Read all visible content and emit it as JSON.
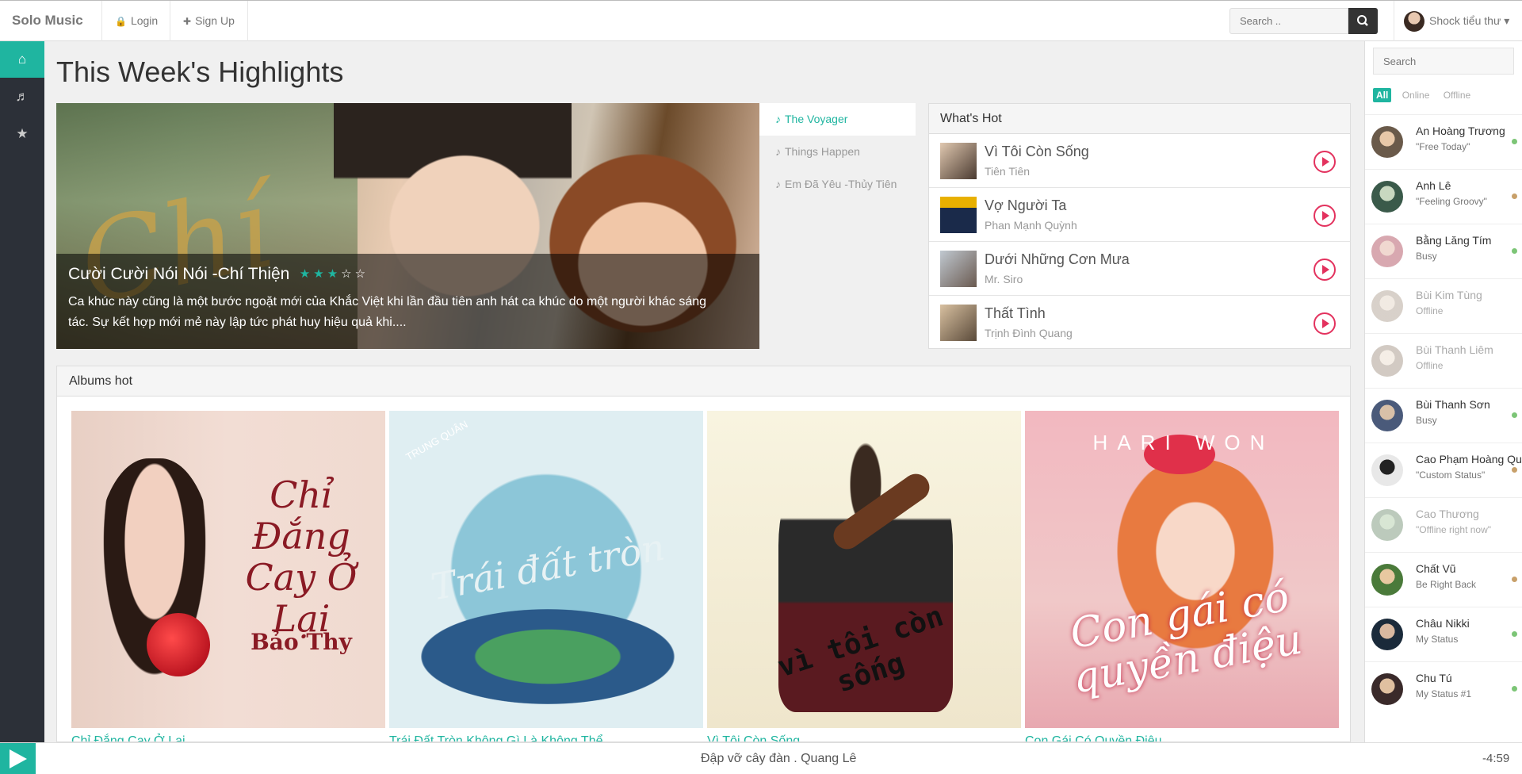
{
  "app": {
    "brand": "Solo Music"
  },
  "nav": {
    "login": "Login",
    "signup": "Sign Up",
    "search_placeholder": "Search ..",
    "user_name": "Shock tiểu thư"
  },
  "main": {
    "page_title": "This Week's Highlights",
    "slider": {
      "title": "Cười Cười Nói Nói -Chí Thiện",
      "rating": 3,
      "rating_max": 5,
      "description": "Ca khúc này cũng là một bước ngoặt mới của Khắc Việt khi lần đầu tiên anh hát ca khúc do một người khác sáng tác. Sự kết hợp mới mẻ này lập tức phát huy hiệu quả khi....",
      "tabs": [
        "The Voyager",
        "Things Happen",
        "Em Đã Yêu -Thủy Tiên"
      ]
    },
    "hot": {
      "heading": "What's Hot",
      "items": [
        {
          "title": "Vì Tôi Còn Sống",
          "artist": "Tiên Tiên"
        },
        {
          "title": "Vợ Người Ta",
          "artist": "Phan Mạnh Quỳnh"
        },
        {
          "title": "Dưới Những Cơn Mưa",
          "artist": "Mr. Siro"
        },
        {
          "title": "Thất Tình",
          "artist": "Trịnh Đình Quang"
        }
      ]
    },
    "albums": {
      "heading": "Albums hot",
      "items": [
        {
          "title": "Chỉ Đắng Cay Ở Lại",
          "cover_text": "Chỉ Đắng Cay Ở Lại",
          "cover_sub": "Bảo Thy"
        },
        {
          "title": "Trái Đất Tròn Không Gì Là Không Thể",
          "cover_text": "Trái đất tròn",
          "cover_sub": "TRUNG QUÂN"
        },
        {
          "title": "Vì Tôi Còn Sống",
          "cover_text": "vì tôi còn sống",
          "cover_sub": ""
        },
        {
          "title": "Con Gái Có Quyền Điệu",
          "cover_text": "Con gái có quyền điệu",
          "cover_sub": "HARI WON"
        }
      ]
    }
  },
  "chat": {
    "search_placeholder": "Search",
    "filters": [
      "All",
      "Online",
      "Offline"
    ],
    "contacts": [
      {
        "name": "An Hoàng Trương",
        "status": "\"Free Today\"",
        "presence": "online"
      },
      {
        "name": "Anh Lê",
        "status": "\"Feeling Groovy\"",
        "presence": "away"
      },
      {
        "name": "Bằng Lăng Tím",
        "status": "Busy",
        "presence": "online"
      },
      {
        "name": "Bùi Kim Tùng",
        "status": "Offline",
        "presence": "offline"
      },
      {
        "name": "Bùi Thanh Liêm",
        "status": "Offline",
        "presence": "offline"
      },
      {
        "name": "Bùi Thanh Sơn",
        "status": "Busy",
        "presence": "online"
      },
      {
        "name": "Cao Phạm Hoàng Quyên",
        "status": "\"Custom Status\"",
        "presence": "away"
      },
      {
        "name": "Cao Thương",
        "status": "\"Offline right now\"",
        "presence": "offline"
      },
      {
        "name": "Chất Vũ",
        "status": "Be Right Back",
        "presence": "away"
      },
      {
        "name": "Châu Nikki",
        "status": "My Status",
        "presence": "online"
      },
      {
        "name": "Chu Tú",
        "status": "My Status #1",
        "presence": "online"
      }
    ]
  },
  "player": {
    "track": "Đập vỡ cây đàn . Quang Lê",
    "time": "-4:59"
  },
  "colors": {
    "accent": "#1fb5a0",
    "play_red": "#e3325e",
    "online": "#7cc576",
    "away": "#c8a06a"
  }
}
